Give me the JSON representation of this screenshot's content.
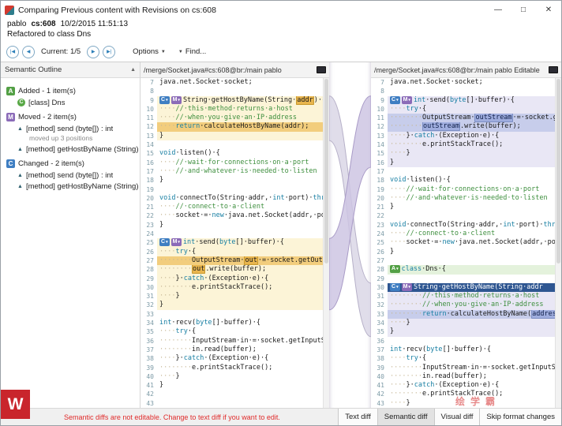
{
  "window": {
    "title": "Comparing Previous content with Revisions on cs:608",
    "controls": {
      "minimize": "—",
      "maximize": "□",
      "close": "✕"
    }
  },
  "header": {
    "author": "pablo",
    "changeset": "cs:608",
    "datetime": "10/2/2015 11:51:13",
    "comment": "Refactored to class Dns"
  },
  "toolbar": {
    "nav_first": "|◀",
    "nav_prev": "◀",
    "current": "Current: 1/5",
    "nav_next": "▶",
    "nav_last": "▶|",
    "options": "Options",
    "options_caret": "▼",
    "find_caret": "▼",
    "find": "Find..."
  },
  "outline": {
    "title": "Semantic Outline",
    "collapse_icon": "▲",
    "groups": [
      {
        "badge": "A",
        "label": "Added - 1 item(s)",
        "items": [
          {
            "icon": "class",
            "label": "[class] Dns"
          }
        ]
      },
      {
        "badge": "M",
        "label": "Moved - 2 item(s)",
        "items": [
          {
            "icon": "method",
            "label": "[method] send (byte[]) : int",
            "note": "moved up 3 positions"
          },
          {
            "icon": "method",
            "label": "[method] getHostByName (String) : S"
          }
        ]
      },
      {
        "badge": "C",
        "label": "Changed - 2 item(s)",
        "items": [
          {
            "icon": "method",
            "label": "[method] send (byte[]) : int"
          },
          {
            "icon": "method",
            "label": "[method] getHostByName (String) : S"
          }
        ]
      }
    ]
  },
  "first_line": 7,
  "left_panel": {
    "title": "/merge/Socket.java#cs:608@br:/main pablo",
    "lines": [
      {
        "n": 7,
        "s": [
          [
            "t",
            "java.net.Socket·socket;"
          ]
        ]
      },
      {
        "n": 8,
        "s": []
      },
      {
        "n": 9,
        "bg": "mv1",
        "b": [
          "C",
          "M"
        ],
        "s": [
          [
            "t",
            "String·getHostByName(String·"
          ],
          [
            "b1",
            "addr"
          ],
          [
            "t",
            ")·{"
          ]
        ]
      },
      {
        "n": 10,
        "bg": "mv1",
        "s": [
          [
            "w",
            "····"
          ],
          [
            "c",
            "//·this·method·returns·a·host"
          ]
        ]
      },
      {
        "n": 11,
        "bg": "mv1",
        "s": [
          [
            "w",
            "····"
          ],
          [
            "c",
            "//·when·you·give·an·IP·address"
          ]
        ]
      },
      {
        "n": 12,
        "bg": "ch1",
        "s": [
          [
            "w",
            "····"
          ],
          [
            "k",
            "return"
          ],
          [
            "t",
            "·calculateHostByName(addr);"
          ]
        ]
      },
      {
        "n": 13,
        "bg": "mv1",
        "s": [
          [
            "t",
            "}"
          ]
        ]
      },
      {
        "n": 14,
        "s": []
      },
      {
        "n": 15,
        "s": [
          [
            "k",
            "void"
          ],
          [
            "t",
            "·listen()·{"
          ]
        ]
      },
      {
        "n": 16,
        "s": [
          [
            "w",
            "····"
          ],
          [
            "c",
            "//·wait·for·connections·on·a·port"
          ]
        ]
      },
      {
        "n": 17,
        "s": [
          [
            "w",
            "····"
          ],
          [
            "c",
            "//·and·whatever·is·needed·to·listen"
          ]
        ]
      },
      {
        "n": 18,
        "s": [
          [
            "t",
            "}"
          ]
        ]
      },
      {
        "n": 19,
        "s": []
      },
      {
        "n": 20,
        "s": [
          [
            "k",
            "void"
          ],
          [
            "t",
            "·connectTo(String·addr,·"
          ],
          [
            "k",
            "int"
          ],
          [
            "t",
            "·port)·"
          ],
          [
            "k",
            "throws"
          ]
        ]
      },
      {
        "n": 21,
        "s": [
          [
            "w",
            "····"
          ],
          [
            "c",
            "//·connect·to·a·client"
          ]
        ]
      },
      {
        "n": 22,
        "s": [
          [
            "w",
            "····"
          ],
          [
            "t",
            "socket·=·"
          ],
          [
            "k",
            "new"
          ],
          [
            "t",
            "·java.net.Socket(addr,·port)"
          ]
        ]
      },
      {
        "n": 23,
        "s": [
          [
            "t",
            "}"
          ]
        ]
      },
      {
        "n": 24,
        "s": []
      },
      {
        "n": 25,
        "bg": "mv1",
        "b": [
          "C",
          "M"
        ],
        "s": [
          [
            "k",
            "int"
          ],
          [
            "t",
            "·send("
          ],
          [
            "k",
            "byte"
          ],
          [
            "t",
            "[]·buffer)·{"
          ]
        ]
      },
      {
        "n": 26,
        "bg": "mv1",
        "s": [
          [
            "w",
            "····"
          ],
          [
            "k",
            "try"
          ],
          [
            "t",
            "·{"
          ]
        ]
      },
      {
        "n": 27,
        "bg": "ch1",
        "s": [
          [
            "w",
            "········"
          ],
          [
            "t",
            "OutputStream·"
          ],
          [
            "b1",
            "out"
          ],
          [
            "t",
            "·=·socket.getOutputS"
          ]
        ]
      },
      {
        "n": 28,
        "bg": "mv1",
        "s": [
          [
            "w",
            "········"
          ],
          [
            "b1",
            "out"
          ],
          [
            "t",
            ".write(buffer);"
          ]
        ]
      },
      {
        "n": 29,
        "bg": "mv1",
        "s": [
          [
            "w",
            "····"
          ],
          [
            "t",
            "}·"
          ],
          [
            "k",
            "catch"
          ],
          [
            "t",
            "·(Exception·e)·{"
          ]
        ]
      },
      {
        "n": 30,
        "bg": "mv1",
        "s": [
          [
            "w",
            "········"
          ],
          [
            "t",
            "e.printStackTrace();"
          ]
        ]
      },
      {
        "n": 31,
        "bg": "mv1",
        "s": [
          [
            "w",
            "····"
          ],
          [
            "t",
            "}"
          ]
        ]
      },
      {
        "n": 32,
        "bg": "mv1",
        "s": [
          [
            "t",
            "}"
          ]
        ]
      },
      {
        "n": 33,
        "s": []
      },
      {
        "n": 34,
        "s": [
          [
            "k",
            "int"
          ],
          [
            "t",
            "·recv("
          ],
          [
            "k",
            "byte"
          ],
          [
            "t",
            "[]·buffer)·{"
          ]
        ]
      },
      {
        "n": 35,
        "s": [
          [
            "w",
            "····"
          ],
          [
            "k",
            "try"
          ],
          [
            "t",
            "·{"
          ]
        ]
      },
      {
        "n": 36,
        "s": [
          [
            "w",
            "········"
          ],
          [
            "t",
            "InputStream·in·=·socket.getInputStre"
          ]
        ]
      },
      {
        "n": 37,
        "s": [
          [
            "w",
            "········"
          ],
          [
            "t",
            "in.read(buffer);"
          ]
        ]
      },
      {
        "n": 38,
        "s": [
          [
            "w",
            "····"
          ],
          [
            "t",
            "}·"
          ],
          [
            "k",
            "catch"
          ],
          [
            "t",
            "·(Exception·e)·{"
          ]
        ]
      },
      {
        "n": 39,
        "s": [
          [
            "w",
            "········"
          ],
          [
            "t",
            "e.printStackTrace();"
          ]
        ]
      },
      {
        "n": 40,
        "s": [
          [
            "w",
            "····"
          ],
          [
            "t",
            "}"
          ]
        ]
      },
      {
        "n": 41,
        "s": [
          [
            "t",
            "}"
          ]
        ]
      },
      {
        "n": 42,
        "s": []
      },
      {
        "n": 43,
        "s": []
      }
    ]
  },
  "right_panel": {
    "title": "/merge/Socket.java#cs:608@br:/main pablo Editable",
    "lines": [
      {
        "n": 7,
        "s": [
          [
            "t",
            "java.net.Socket·socket;"
          ]
        ]
      },
      {
        "n": 8,
        "s": []
      },
      {
        "n": 9,
        "bg": "mv2",
        "b": [
          "C",
          "M"
        ],
        "s": [
          [
            "k",
            "int"
          ],
          [
            "t",
            "·send("
          ],
          [
            "k",
            "byte"
          ],
          [
            "t",
            "[]·buffer)·{"
          ]
        ]
      },
      {
        "n": 10,
        "bg": "mv2",
        "s": [
          [
            "w",
            "····"
          ],
          [
            "k",
            "try"
          ],
          [
            "t",
            "·{"
          ]
        ]
      },
      {
        "n": 11,
        "bg": "ch2",
        "s": [
          [
            "w",
            "········"
          ],
          [
            "t",
            "OutputStream·"
          ],
          [
            "b2",
            "outStream"
          ],
          [
            "t",
            "·=·socket.getO"
          ]
        ]
      },
      {
        "n": 12,
        "bg": "ch2",
        "s": [
          [
            "w",
            "········"
          ],
          [
            "b2",
            "outStream"
          ],
          [
            "t",
            ".write(buffer);"
          ]
        ]
      },
      {
        "n": 13,
        "bg": "mv2",
        "s": [
          [
            "w",
            "····"
          ],
          [
            "t",
            "}·"
          ],
          [
            "k",
            "catch"
          ],
          [
            "t",
            "·(Exception·e)·{"
          ]
        ]
      },
      {
        "n": 14,
        "bg": "mv2",
        "s": [
          [
            "w",
            "········"
          ],
          [
            "t",
            "e.printStackTrace();"
          ]
        ]
      },
      {
        "n": 15,
        "bg": "mv2",
        "s": [
          [
            "w",
            "····"
          ],
          [
            "t",
            "}"
          ]
        ]
      },
      {
        "n": 16,
        "bg": "mv2",
        "s": [
          [
            "t",
            "}"
          ]
        ]
      },
      {
        "n": 17,
        "s": []
      },
      {
        "n": 18,
        "s": [
          [
            "k",
            "void"
          ],
          [
            "t",
            "·listen()·{"
          ]
        ]
      },
      {
        "n": 19,
        "s": [
          [
            "w",
            "····"
          ],
          [
            "c",
            "//·wait·for·connections·on·a·port"
          ]
        ]
      },
      {
        "n": 20,
        "s": [
          [
            "w",
            "····"
          ],
          [
            "c",
            "//·and·whatever·is·needed·to·listen"
          ]
        ]
      },
      {
        "n": 21,
        "s": [
          [
            "t",
            "}"
          ]
        ]
      },
      {
        "n": 22,
        "s": []
      },
      {
        "n": 23,
        "s": [
          [
            "k",
            "void"
          ],
          [
            "t",
            "·connectTo(String·addr,·"
          ],
          [
            "k",
            "int"
          ],
          [
            "t",
            "·port)·"
          ],
          [
            "k",
            "throws"
          ]
        ]
      },
      {
        "n": 24,
        "s": [
          [
            "w",
            "····"
          ],
          [
            "c",
            "//·connect·to·a·client"
          ]
        ]
      },
      {
        "n": 25,
        "s": [
          [
            "w",
            "····"
          ],
          [
            "t",
            "socket·=·"
          ],
          [
            "k",
            "new"
          ],
          [
            "t",
            "·java.net.Socket(addr,·port)"
          ]
        ]
      },
      {
        "n": 26,
        "s": [
          [
            "t",
            "}"
          ]
        ]
      },
      {
        "n": 27,
        "s": []
      },
      {
        "n": 28,
        "bg": "add",
        "b": [
          "A"
        ],
        "s": [
          [
            "k",
            "class"
          ],
          [
            "t",
            "·Dns·{"
          ]
        ]
      },
      {
        "n": 29,
        "s": []
      },
      {
        "n": 30,
        "bg": "sel",
        "b": [
          "C",
          "M"
        ],
        "s": [
          [
            "sel",
            "String·getHostByName(String·addr"
          ]
        ]
      },
      {
        "n": 31,
        "bg": "mv2",
        "s": [
          [
            "w",
            "········"
          ],
          [
            "c",
            "//·this·method·returns·a·host"
          ]
        ]
      },
      {
        "n": 32,
        "bg": "mv2",
        "s": [
          [
            "w",
            "········"
          ],
          [
            "c",
            "//·when·you·give·an·IP·address"
          ]
        ]
      },
      {
        "n": 33,
        "bg": "ch2",
        "s": [
          [
            "w",
            "········"
          ],
          [
            "k",
            "return"
          ],
          [
            "t",
            "·calculateHostByName("
          ],
          [
            "b2",
            "address"
          ],
          [
            "t",
            ");"
          ]
        ]
      },
      {
        "n": 34,
        "bg": "mv2",
        "s": [
          [
            "w",
            "····"
          ],
          [
            "t",
            "}"
          ]
        ]
      },
      {
        "n": 35,
        "bg": "mv2",
        "s": [
          [
            "t",
            "}"
          ]
        ]
      },
      {
        "n": 36,
        "s": []
      },
      {
        "n": 37,
        "s": [
          [
            "k",
            "int"
          ],
          [
            "t",
            "·recv("
          ],
          [
            "k",
            "byte"
          ],
          [
            "t",
            "[]·buffer)·{"
          ]
        ]
      },
      {
        "n": 38,
        "s": [
          [
            "w",
            "····"
          ],
          [
            "k",
            "try"
          ],
          [
            "t",
            "·{"
          ]
        ]
      },
      {
        "n": 39,
        "s": [
          [
            "w",
            "········"
          ],
          [
            "t",
            "InputStream·in·=·socket.getInputStre"
          ]
        ]
      },
      {
        "n": 40,
        "s": [
          [
            "w",
            "········"
          ],
          [
            "t",
            "in.read(buffer);"
          ]
        ]
      },
      {
        "n": 41,
        "s": [
          [
            "w",
            "····"
          ],
          [
            "t",
            "}·"
          ],
          [
            "k",
            "catch"
          ],
          [
            "t",
            "·(Exception·e)·{"
          ]
        ]
      },
      {
        "n": 42,
        "s": [
          [
            "w",
            "········"
          ],
          [
            "t",
            "e.printStackTrace();"
          ]
        ]
      },
      {
        "n": 43,
        "s": [
          [
            "w",
            "····"
          ],
          [
            "t",
            "}"
          ]
        ]
      }
    ]
  },
  "moves": [
    {
      "kind": "gethost",
      "left_start": 9,
      "left_end": 13,
      "right_start": 30,
      "right_end": 35
    },
    {
      "kind": "send",
      "left_start": 25,
      "left_end": 32,
      "right_start": 9,
      "right_end": 16
    }
  ],
  "footer": {
    "warning": "Semantic diffs are not editable. Change to text diff if you want to edit.",
    "buttons": [
      {
        "label": "Text diff",
        "active": false
      },
      {
        "label": "Semantic diff",
        "active": true
      },
      {
        "label": "Visual diff",
        "active": false
      },
      {
        "label": "Skip format changes",
        "active": false
      }
    ]
  },
  "watermark": {
    "logo": "W",
    "brand": "绘学霸"
  },
  "colors": {
    "added": "#53a045",
    "moved": "#8b6bb8",
    "changed": "#3f7ec2",
    "selection": "#2e5691",
    "warning": "#e02b2b"
  }
}
